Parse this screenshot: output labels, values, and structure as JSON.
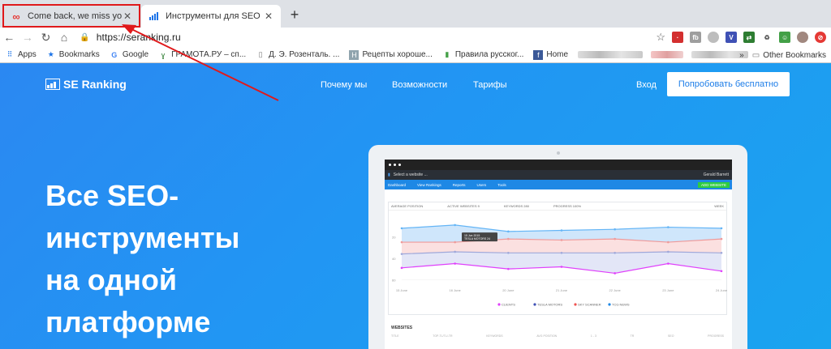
{
  "tabs": [
    {
      "title": "Come back, we miss you!",
      "icon": "infinity-icon",
      "color": "#e53935"
    },
    {
      "title": "Инструменты для SEO и онла",
      "icon": "bar-chart-icon",
      "color": "#1a73e8"
    }
  ],
  "toolbar": {
    "url": "https://seranking.ru"
  },
  "bookmarks": [
    "Apps",
    "Bookmarks",
    "Google",
    "ГРАМОТА.РУ – сп...",
    "Д. Э. Розенталь. ...",
    "Рецепты хороше...",
    "Правила русског...",
    "Home"
  ],
  "bookmarks_right": {
    "more": "»",
    "other": "Other Bookmarks"
  },
  "site": {
    "logo": "SE Ranking",
    "nav": [
      "Почему мы",
      "Возможности",
      "Тарифы"
    ],
    "login": "Вход",
    "cta": "Попробовать бесплатно",
    "hero": [
      "Все SEO-",
      "инструменты",
      "на одной",
      "платформе"
    ]
  },
  "mockup": {
    "project": "Select a website ...",
    "user": "Gerald Barrett",
    "nav": [
      "Dashboard",
      "View Rankings",
      "Reports",
      "Users",
      "Tools"
    ],
    "add_website": "ADD WEBSITE",
    "filters": [
      "AVERAGE POSITION",
      "ACTIVE WEBSITES 9",
      "KEYWORDS 280",
      "PROGRESS 100%"
    ],
    "period": "WEEK",
    "tooltip": [
      "15 Jun 2015",
      "TESLA MOTORS 24"
    ],
    "legend": [
      "CLIENTS",
      "TESLA MOTORS",
      "SKY SCANNER",
      "TCG NEWS"
    ],
    "legend_colors": [
      "#e040fb",
      "#3f51b5",
      "#ef5350",
      "#1e88e5"
    ],
    "websites_title": "WEBSITES",
    "columns": [
      "TITLE",
      "TOP-TL/TL/-TR",
      "KEYWORDS",
      "AVG POSITION",
      "1 - 3",
      "TR",
      "SEO",
      "PROGRESS"
    ]
  },
  "chart_data": {
    "type": "line",
    "x": [
      "15 June",
      "16 June",
      "20 June",
      "21 June",
      "22 June",
      "23 June",
      "24 June"
    ],
    "ylim": [
      0,
      65
    ],
    "yticks": [
      20,
      40,
      60
    ],
    "series": [
      {
        "name": "TCG NEWS",
        "color": "#64b5f6",
        "values": [
          12,
          9,
          15,
          14,
          13,
          11,
          12
        ]
      },
      {
        "name": "SKY SCANNER",
        "color": "#ef9a9a",
        "values": [
          25,
          25,
          22,
          23,
          22,
          25,
          22
        ]
      },
      {
        "name": "TESLA MOTORS",
        "color": "#9fa8da",
        "values": [
          36,
          34,
          35,
          35,
          35,
          34,
          35
        ]
      },
      {
        "name": "CLIENTS",
        "color": "#e040fb",
        "values": [
          49,
          45,
          50,
          48,
          54,
          45,
          52
        ]
      }
    ]
  }
}
